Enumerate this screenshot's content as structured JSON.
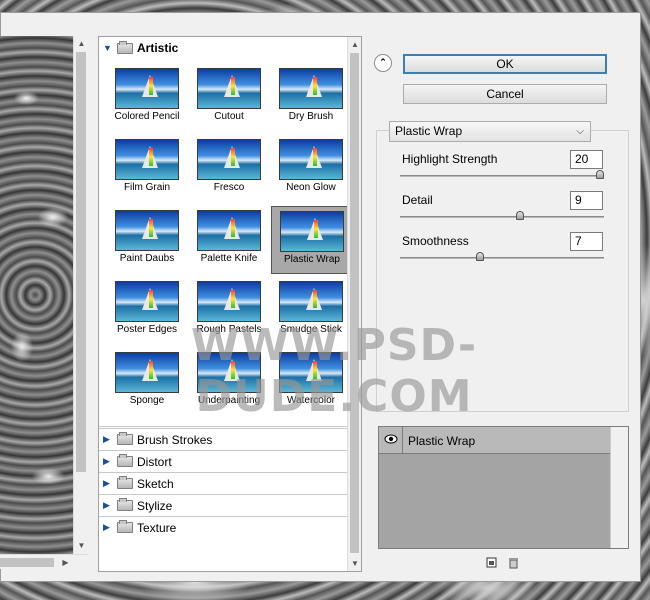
{
  "browser": {
    "open_category": "Artistic",
    "filters": [
      {
        "label": "Colored Pencil"
      },
      {
        "label": "Cutout"
      },
      {
        "label": "Dry Brush"
      },
      {
        "label": "Film Grain"
      },
      {
        "label": "Fresco"
      },
      {
        "label": "Neon Glow"
      },
      {
        "label": "Paint Daubs"
      },
      {
        "label": "Palette Knife"
      },
      {
        "label": "Plastic Wrap"
      },
      {
        "label": "Poster Edges"
      },
      {
        "label": "Rough Pastels"
      },
      {
        "label": "Smudge Stick"
      },
      {
        "label": "Sponge"
      },
      {
        "label": "Underpainting"
      },
      {
        "label": "Watercolor"
      }
    ],
    "selected_filter": "Plastic Wrap",
    "collapsed_categories": [
      "Brush Strokes",
      "Distort",
      "Sketch",
      "Stylize",
      "Texture"
    ]
  },
  "buttons": {
    "ok": "OK",
    "cancel": "Cancel"
  },
  "settings": {
    "filter_select": "Plastic Wrap",
    "params": [
      {
        "label": "Highlight Strength",
        "value": "20",
        "level": 1.0
      },
      {
        "label": "Detail",
        "value": "9",
        "level": 0.6
      },
      {
        "label": "Smoothness",
        "value": "7",
        "level": 0.4
      }
    ]
  },
  "layers": {
    "effect_label": "Plastic Wrap"
  },
  "watermark": "WWW.PSD-DUDE.COM",
  "colors": {
    "dialog_bg": "#f0f0f0",
    "ok_border": "#3c7fb1",
    "selected_cell": "#a8a8a8",
    "layers_bg": "#a4a4a4"
  },
  "icons": {
    "collapse": "chevron-double-up-icon",
    "new_layer": "new-layer-icon",
    "delete": "trash-icon",
    "eye": "eye-icon"
  }
}
